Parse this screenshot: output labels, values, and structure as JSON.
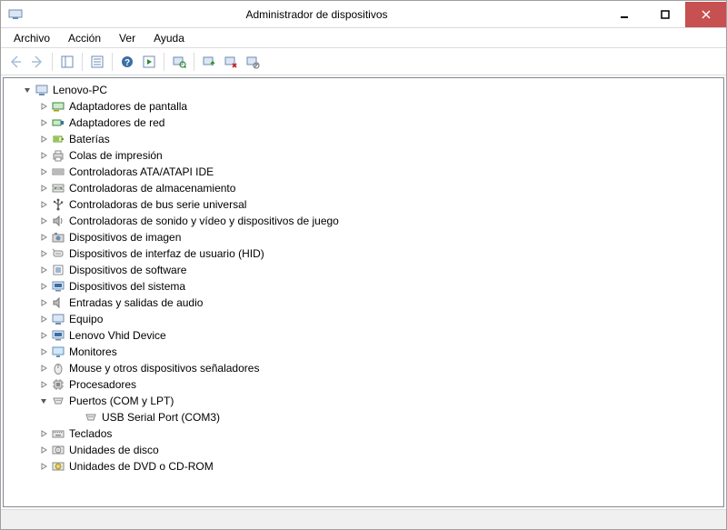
{
  "window": {
    "title": "Administrador de dispositivos"
  },
  "menu": {
    "items": [
      {
        "label": "Archivo"
      },
      {
        "label": "Acción"
      },
      {
        "label": "Ver"
      },
      {
        "label": "Ayuda"
      }
    ]
  },
  "toolbar": {
    "icons": [
      "back-arrow-icon",
      "forward-arrow-icon",
      "show-hide-tree-icon",
      "properties-icon",
      "help-icon",
      "action-icon",
      "scan-hardware-icon",
      "update-driver-icon",
      "uninstall-icon",
      "disable-icon"
    ]
  },
  "tree": {
    "root": {
      "label": "Lenovo-PC",
      "icon": "computer-icon",
      "expanded": true
    },
    "categories": [
      {
        "label": "Adaptadores de pantalla",
        "icon": "display-adapter-icon",
        "expanded": false
      },
      {
        "label": "Adaptadores de red",
        "icon": "network-adapter-icon",
        "expanded": false
      },
      {
        "label": "Baterías",
        "icon": "battery-icon",
        "expanded": false
      },
      {
        "label": "Colas de impresión",
        "icon": "printer-icon",
        "expanded": false
      },
      {
        "label": "Controladoras ATA/ATAPI IDE",
        "icon": "ide-controller-icon",
        "expanded": false
      },
      {
        "label": "Controladoras de almacenamiento",
        "icon": "storage-controller-icon",
        "expanded": false
      },
      {
        "label": "Controladoras de bus serie universal",
        "icon": "usb-controller-icon",
        "expanded": false
      },
      {
        "label": "Controladoras de sonido y vídeo y dispositivos de juego",
        "icon": "sound-icon",
        "expanded": false
      },
      {
        "label": "Dispositivos de imagen",
        "icon": "imaging-device-icon",
        "expanded": false
      },
      {
        "label": "Dispositivos de interfaz de usuario (HID)",
        "icon": "hid-icon",
        "expanded": false
      },
      {
        "label": "Dispositivos de software",
        "icon": "software-device-icon",
        "expanded": false
      },
      {
        "label": "Dispositivos del sistema",
        "icon": "system-device-icon",
        "expanded": false
      },
      {
        "label": "Entradas y salidas de audio",
        "icon": "audio-io-icon",
        "expanded": false
      },
      {
        "label": "Equipo",
        "icon": "computer-icon",
        "expanded": false
      },
      {
        "label": "Lenovo Vhid Device",
        "icon": "system-device-icon",
        "expanded": false
      },
      {
        "label": "Monitores",
        "icon": "monitor-icon",
        "expanded": false
      },
      {
        "label": "Mouse y otros dispositivos señaladores",
        "icon": "mouse-icon",
        "expanded": false
      },
      {
        "label": "Procesadores",
        "icon": "processor-icon",
        "expanded": false
      },
      {
        "label": "Puertos (COM y LPT)",
        "icon": "port-icon",
        "expanded": true,
        "children": [
          {
            "label": "USB Serial Port (COM3)",
            "icon": "port-icon"
          }
        ]
      },
      {
        "label": "Teclados",
        "icon": "keyboard-icon",
        "expanded": false
      },
      {
        "label": "Unidades de disco",
        "icon": "disk-drive-icon",
        "expanded": false
      },
      {
        "label": "Unidades de DVD o CD-ROM",
        "icon": "dvd-drive-icon",
        "expanded": false
      }
    ]
  }
}
